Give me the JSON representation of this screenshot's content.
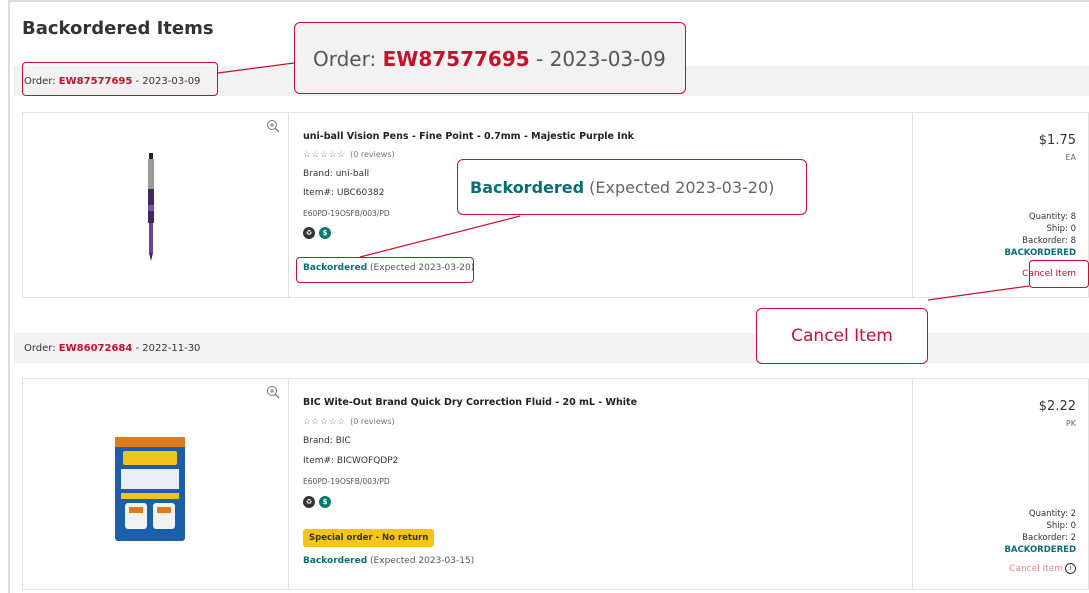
{
  "page_title": "Backordered Items",
  "labels": {
    "order_prefix": "Order: ",
    "sep": " - ",
    "brand_prefix": "Brand: ",
    "item_prefix": "Item#: ",
    "quantity_prefix": "Quantity: ",
    "ship_prefix": "Ship: ",
    "backorder_prefix": "Backorder: ",
    "reviews": "(0 reviews)",
    "stars": "☆☆☆☆☆"
  },
  "callouts": {
    "order": {
      "prefix": "Order: ",
      "number": "EW87577695",
      "sep": " - ",
      "date": "2023-03-09"
    },
    "status": {
      "status": "Backordered",
      "expected": "(Expected 2023-03-20)"
    },
    "cancel": "Cancel Item"
  },
  "orders": [
    {
      "number": "EW87577695",
      "date": "2023-03-09",
      "item": {
        "title": "uni-ball Vision Pens - Fine Point - 0.7mm - Majestic Purple Ink",
        "brand": "uni-ball",
        "item_no": "UBC60382",
        "code": "E60PD-19OSFB/003/PD",
        "status": "Backordered",
        "expected": "(Expected 2023-03-20)",
        "price": "$1.75",
        "unit": "EA",
        "quantity": "8",
        "ship": "0",
        "backorder": "8",
        "backorder_status": "BACKORDERED",
        "cancel_label": "Cancel Item"
      }
    },
    {
      "number": "EW86072684",
      "date": "2022-11-30",
      "item": {
        "title": "BIC Wite-Out Brand Quick Dry Correction Fluid - 20 mL - White",
        "brand": "BIC",
        "item_no": "BICWOFQDP2",
        "code": "E60PD-19OSFB/003/PD",
        "special": "Special order - No return",
        "status": "Backordered",
        "expected": "(Expected 2023-03-15)",
        "price": "$2.22",
        "unit": "PK",
        "quantity": "2",
        "ship": "0",
        "backorder": "2",
        "backorder_status": "BACKORDERED",
        "cancel_label": "Cancel Item"
      }
    }
  ],
  "colors": {
    "accent_red": "#c8102e",
    "backordered_teal": "#0a6e78",
    "special_yellow": "#f6c51c"
  }
}
